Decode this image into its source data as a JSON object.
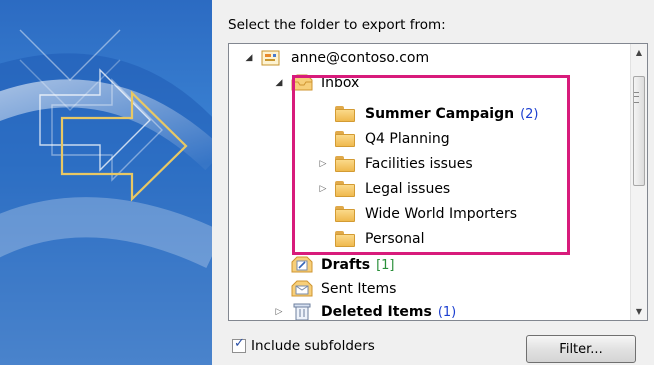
{
  "prompt": "Select the folder to export from:",
  "tree": {
    "account": {
      "label": "anne@contoso.com",
      "icon": "mailbox-icon",
      "expanded": true
    },
    "inbox": {
      "label": "Inbox",
      "icon": "inbox-icon",
      "expanded": true
    },
    "inbox_children": [
      {
        "label": "Summer Campaign",
        "count": "(2)",
        "bold": true,
        "expandable": false
      },
      {
        "label": "Q4 Planning",
        "count": "",
        "bold": false,
        "expandable": false
      },
      {
        "label": "Facilities issues",
        "count": "",
        "bold": false,
        "expandable": true
      },
      {
        "label": "Legal issues",
        "count": "",
        "bold": false,
        "expandable": true
      },
      {
        "label": "Wide World Importers",
        "count": "",
        "bold": false,
        "expandable": false
      },
      {
        "label": "Personal",
        "count": "",
        "bold": false,
        "expandable": false
      }
    ],
    "drafts": {
      "label": "Drafts",
      "count": "[1]",
      "icon": "drafts-icon"
    },
    "sent": {
      "label": "Sent Items",
      "icon": "sent-items-icon"
    },
    "deleted": {
      "label": "Deleted Items",
      "count": "(1)",
      "icon": "deleted-items-icon",
      "expandable": true
    }
  },
  "include_subfolders": {
    "label": "Include subfolders",
    "checked": true
  },
  "filter_button": {
    "label": "Filter..."
  },
  "colors": {
    "highlight": "#d81b7b",
    "count_blue": "#1c3fd0",
    "count_green": "#2a8f3a"
  }
}
